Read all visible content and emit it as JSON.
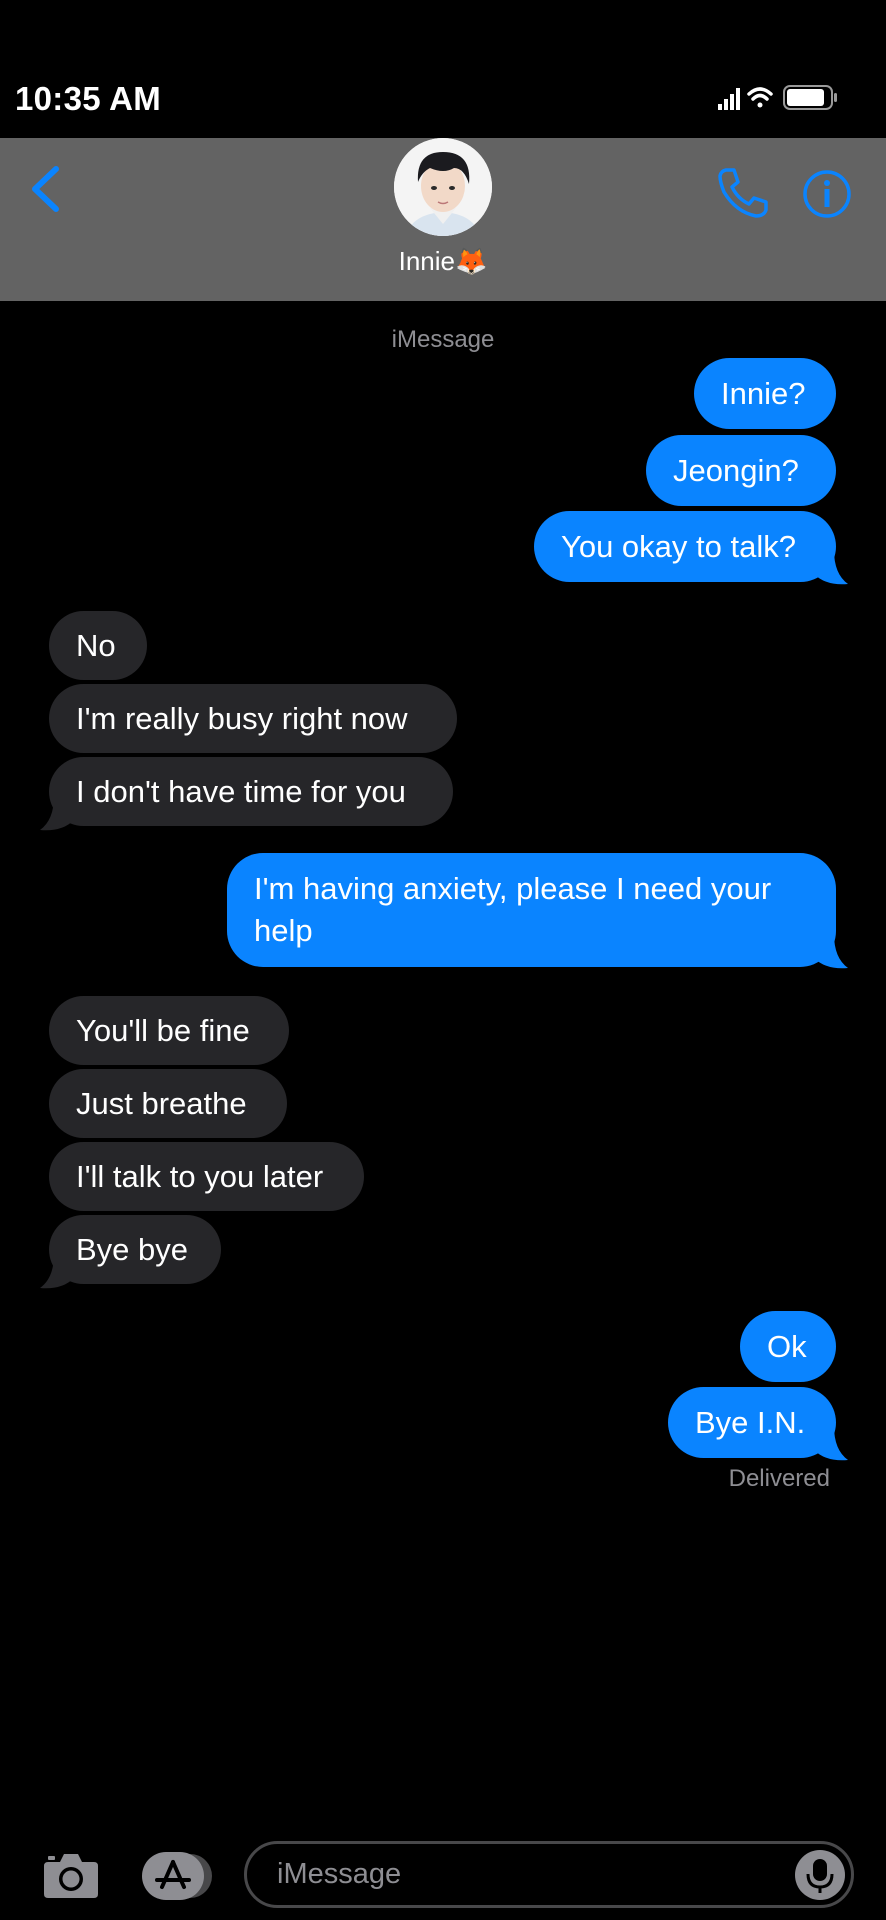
{
  "status_bar": {
    "time": "10:35 AM"
  },
  "header": {
    "contact_name": "Innie🦊"
  },
  "thread": {
    "service_label": "iMessage",
    "messages": [
      {
        "from": "me",
        "text": "Innie?"
      },
      {
        "from": "me",
        "text": "Jeongin?"
      },
      {
        "from": "me",
        "text": "You okay to talk?"
      },
      {
        "from": "them",
        "text": "No"
      },
      {
        "from": "them",
        "text": "I'm really busy right now"
      },
      {
        "from": "them",
        "text": "I don't have time for you"
      },
      {
        "from": "me",
        "text": "I'm having anxiety, please I need your help"
      },
      {
        "from": "them",
        "text": "You'll be fine"
      },
      {
        "from": "them",
        "text": "Just breathe"
      },
      {
        "from": "them",
        "text": "I'll talk to you later"
      },
      {
        "from": "them",
        "text": "Bye bye"
      },
      {
        "from": "me",
        "text": "Ok"
      },
      {
        "from": "me",
        "text": "Bye I.N."
      }
    ],
    "delivery_status": "Delivered"
  },
  "composer": {
    "placeholder": "iMessage"
  },
  "colors": {
    "sent_bubble": "#0a84ff",
    "received_bubble": "#262629",
    "accent": "#0a84ff",
    "header_bg": "#636363"
  },
  "icons": {
    "back": "chevron-left-icon",
    "phone": "phone-icon",
    "info": "info-icon",
    "camera": "camera-icon",
    "apps": "app-store-icon",
    "mic": "microphone-icon"
  }
}
